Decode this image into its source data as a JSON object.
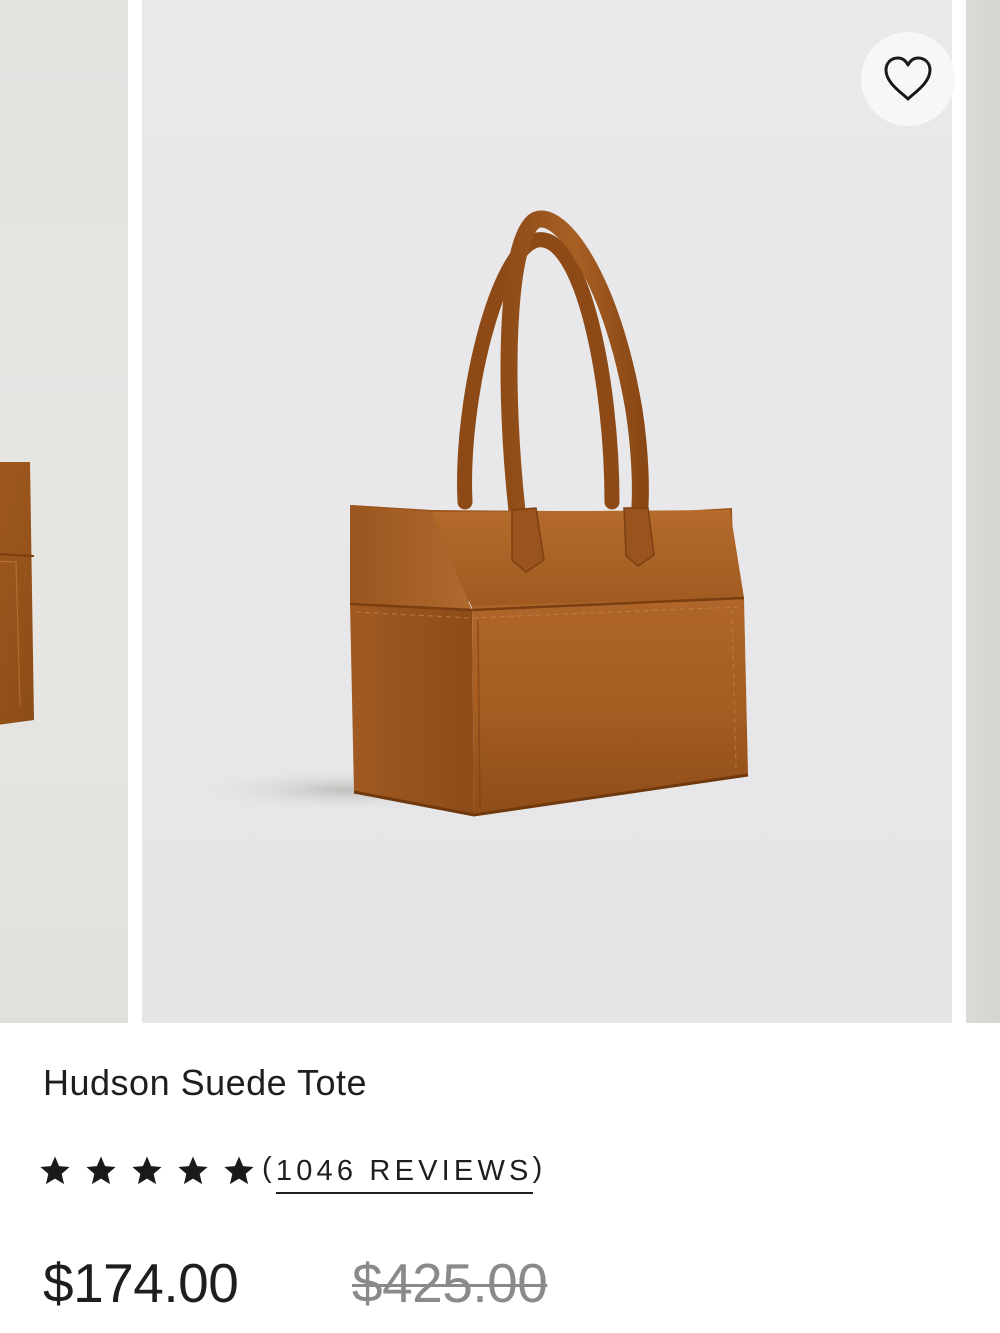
{
  "product": {
    "name": "Hudson Suede Tote",
    "rating": {
      "stars": 5,
      "open_paren": "(",
      "reviews_label": "1046 REVIEWS",
      "close_paren": ")"
    },
    "price": {
      "sale": "$174.00",
      "original": "$425.00"
    }
  },
  "icons": {
    "favorite": "heart-outline-icon",
    "rating_star": "star-filled-icon"
  },
  "colors": {
    "background": "#ffffff",
    "photo_background": "#e8e8ea",
    "suede": "#a0581c",
    "text": "#1e1e1e",
    "original_price": "#8a8a8a"
  }
}
